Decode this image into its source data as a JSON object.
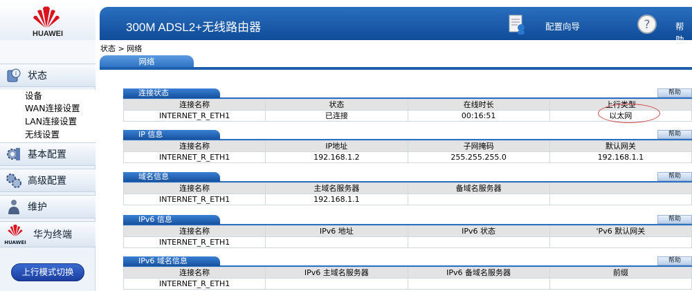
{
  "brand": {
    "name": "HUAWEI"
  },
  "header": {
    "title": "300M ADSL2+无线路由器",
    "wizard_label": "配置向导",
    "help_label": "帮助"
  },
  "breadcrumb": "状态 > 网络",
  "tab": {
    "label": "网络"
  },
  "sidebar": {
    "status": {
      "label": "状态",
      "items": [
        "设备",
        "WAN连接设置",
        "LAN连接设置",
        "无线设置"
      ]
    },
    "basic": {
      "label": "基本配置"
    },
    "advanced": {
      "label": "高级配置"
    },
    "maintain": {
      "label": "维护"
    },
    "terminal": {
      "label": "华为终端",
      "brand_small": "HUAWEI"
    },
    "mode_button": "上行模式切换"
  },
  "help_btn": "帮助",
  "blocks": {
    "conn": {
      "title": "连接状态",
      "headers": [
        "连接名称",
        "状态",
        "在线时长",
        "上行类型"
      ],
      "row": [
        "INTERNET_R_ETH1",
        "已连接",
        "00:16:51",
        "以太网"
      ]
    },
    "ip": {
      "title": "IP 信息",
      "headers": [
        "连接名称",
        "IP地址",
        "子网掩码",
        "默认网关"
      ],
      "row": [
        "INTERNET_R_ETH1",
        "192.168.1.2",
        "255.255.255.0",
        "192.168.1.1"
      ]
    },
    "dns": {
      "title": "域名信息",
      "headers": [
        "连接名称",
        "主域名服务器",
        "备域名服务器",
        ""
      ],
      "row": [
        "INTERNET_R_ETH1",
        "192.168.1.1",
        "",
        ""
      ]
    },
    "ipv6": {
      "title": "IPv6 信息",
      "headers": [
        "连接名称",
        "IPv6 地址",
        "IPv6 状态",
        "'Pv6 默认网关"
      ],
      "row": [
        "INTERNET_R_ETH1",
        "",
        "",
        ""
      ]
    },
    "ipv6dns": {
      "title": "IPv6 域名信息",
      "headers": [
        "连接名称",
        "IPv6 主域名服务器",
        "IPv6 备域名服务器",
        "前缀"
      ],
      "row": [
        "INTERNET_R_ETH1",
        "",
        "",
        ""
      ]
    }
  },
  "colors": {
    "header_blue": "#1e5fb0",
    "annotation_red": "#d04040"
  }
}
